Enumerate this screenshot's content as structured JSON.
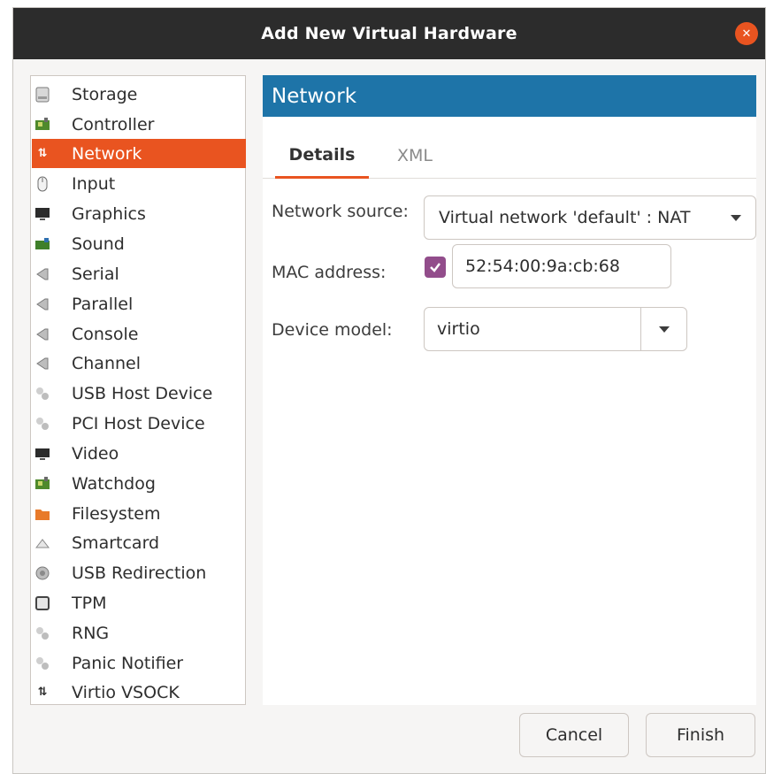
{
  "window": {
    "title": "Add New Virtual Hardware"
  },
  "sidebar": {
    "items": [
      {
        "label": "Storage",
        "icon": "storage-icon"
      },
      {
        "label": "Controller",
        "icon": "controller-icon"
      },
      {
        "label": "Network",
        "icon": "network-icon",
        "selected": true
      },
      {
        "label": "Input",
        "icon": "mouse-icon"
      },
      {
        "label": "Graphics",
        "icon": "monitor-icon"
      },
      {
        "label": "Sound",
        "icon": "sound-card-icon"
      },
      {
        "label": "Serial",
        "icon": "serial-port-icon"
      },
      {
        "label": "Parallel",
        "icon": "parallel-port-icon"
      },
      {
        "label": "Console",
        "icon": "console-port-icon"
      },
      {
        "label": "Channel",
        "icon": "channel-port-icon"
      },
      {
        "label": "USB Host Device",
        "icon": "usb-device-icon"
      },
      {
        "label": "PCI Host Device",
        "icon": "pci-device-icon"
      },
      {
        "label": "Video",
        "icon": "video-icon"
      },
      {
        "label": "Watchdog",
        "icon": "watchdog-icon"
      },
      {
        "label": "Filesystem",
        "icon": "folder-icon"
      },
      {
        "label": "Smartcard",
        "icon": "smartcard-icon"
      },
      {
        "label": "USB Redirection",
        "icon": "usb-redirection-icon"
      },
      {
        "label": "TPM",
        "icon": "tpm-icon"
      },
      {
        "label": "RNG",
        "icon": "rng-icon"
      },
      {
        "label": "Panic Notifier",
        "icon": "panic-notifier-icon"
      },
      {
        "label": "Virtio VSOCK",
        "icon": "vsock-icon"
      }
    ]
  },
  "main": {
    "header": "Network",
    "tabs": [
      {
        "label": "Details",
        "active": true
      },
      {
        "label": "XML",
        "active": false
      }
    ],
    "form": {
      "network_source": {
        "label": "Network source:",
        "value": "Virtual network 'default' : NAT"
      },
      "mac_address": {
        "label": "MAC address:",
        "checked": true,
        "value": "52:54:00:9a:cb:68"
      },
      "device_model": {
        "label": "Device model:",
        "value": "virtio"
      }
    }
  },
  "footer": {
    "cancel_label": "Cancel",
    "finish_label": "Finish"
  },
  "colors": {
    "accent": "#e95420",
    "header_blue": "#1e74a8",
    "checkbox": "#924d8b",
    "titlebar": "#2c2c2c"
  }
}
